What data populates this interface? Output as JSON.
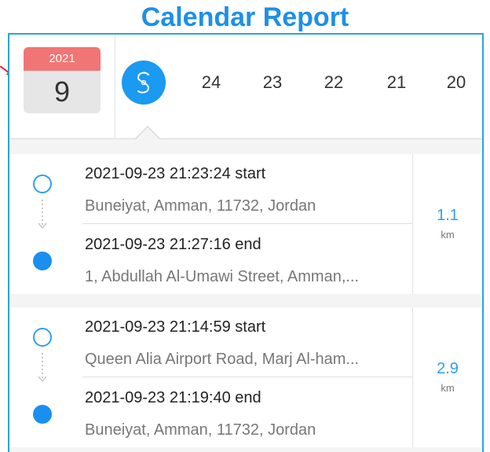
{
  "title": "Calendar Report",
  "calendar": {
    "year": "2021",
    "month": "9"
  },
  "days": [
    "24",
    "23",
    "22",
    "21",
    "20"
  ],
  "trips": [
    {
      "start_time": "2021-09-23 21:23:24 start",
      "start_address": "Buneiyat, Amman, 11732, Jordan",
      "end_time": "2021-09-23 21:27:16 end",
      "end_address": "1, Abdullah Al-Umawi Street, Amman,...",
      "distance": "1.1",
      "unit": "km"
    },
    {
      "start_time": "2021-09-23 21:14:59 start",
      "start_address": "Queen Alia Airport Road, Marj Al-ham...",
      "end_time": "2021-09-23 21:19:40 end",
      "end_address": "Buneiyat, Amman, 11732, Jordan",
      "distance": "2.9",
      "unit": "km"
    }
  ],
  "colors": {
    "accent": "#1a9af0",
    "title": "#1e90e6",
    "calendar_header": "#f27575",
    "frame": "#29a3e0"
  }
}
